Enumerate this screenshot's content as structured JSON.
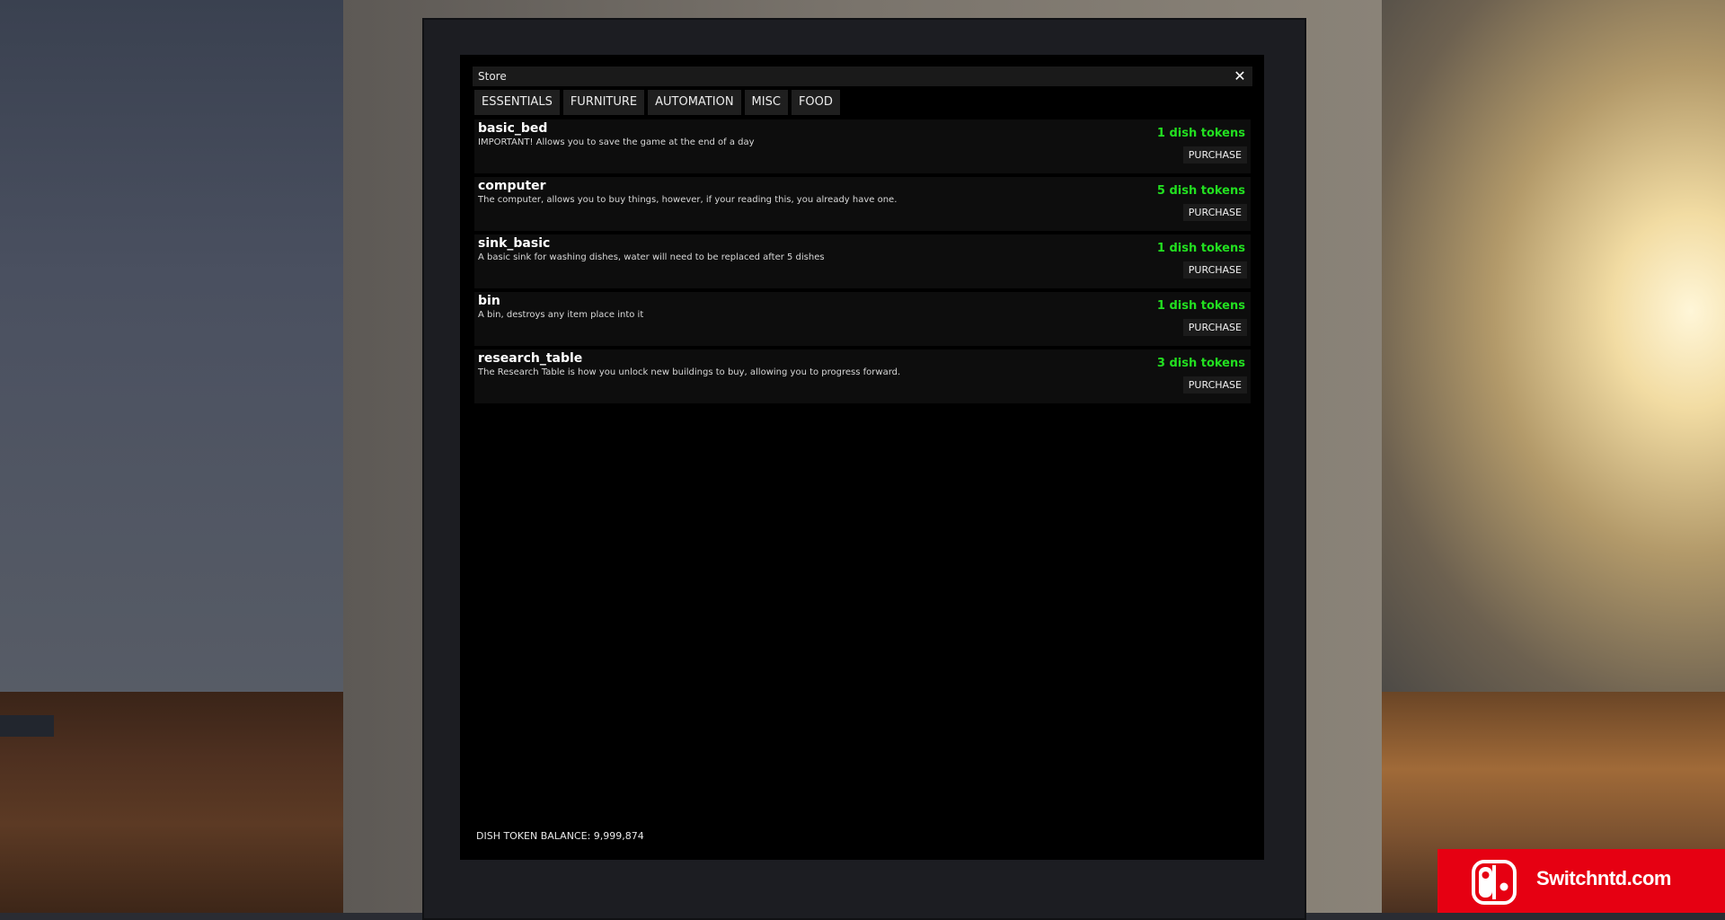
{
  "store": {
    "title": "Store",
    "close_icon": "close-icon",
    "tabs": [
      "ESSENTIALS",
      "FURNITURE",
      "AUTOMATION",
      "MISC",
      "FOOD"
    ],
    "items": [
      {
        "name": "basic_bed",
        "description": "IMPORTANT! Allows you to save the game at the end of a day",
        "price": "1 dish tokens",
        "button": "PURCHASE"
      },
      {
        "name": "computer",
        "description": "The computer, allows you to buy things, however, if your reading this, you already have one.",
        "price": "5 dish tokens",
        "button": "PURCHASE"
      },
      {
        "name": "sink_basic",
        "description": "A basic sink for washing dishes, water will need to be replaced after 5 dishes",
        "price": "1 dish tokens",
        "button": "PURCHASE"
      },
      {
        "name": "bin",
        "description": "A bin, destroys any item place into it",
        "price": "1 dish tokens",
        "button": "PURCHASE"
      },
      {
        "name": "research_table",
        "description": "The Research Table is how you unlock new buildings to buy, allowing you to progress forward.",
        "price": "3 dish tokens",
        "button": "PURCHASE"
      }
    ],
    "balance_label": "DISH TOKEN BALANCE: ",
    "balance_value": "9,999,874"
  },
  "watermark": {
    "text": "Switchntd.com",
    "color": "#e60012"
  },
  "colors": {
    "price": "#22e020",
    "screen": "#000000"
  }
}
